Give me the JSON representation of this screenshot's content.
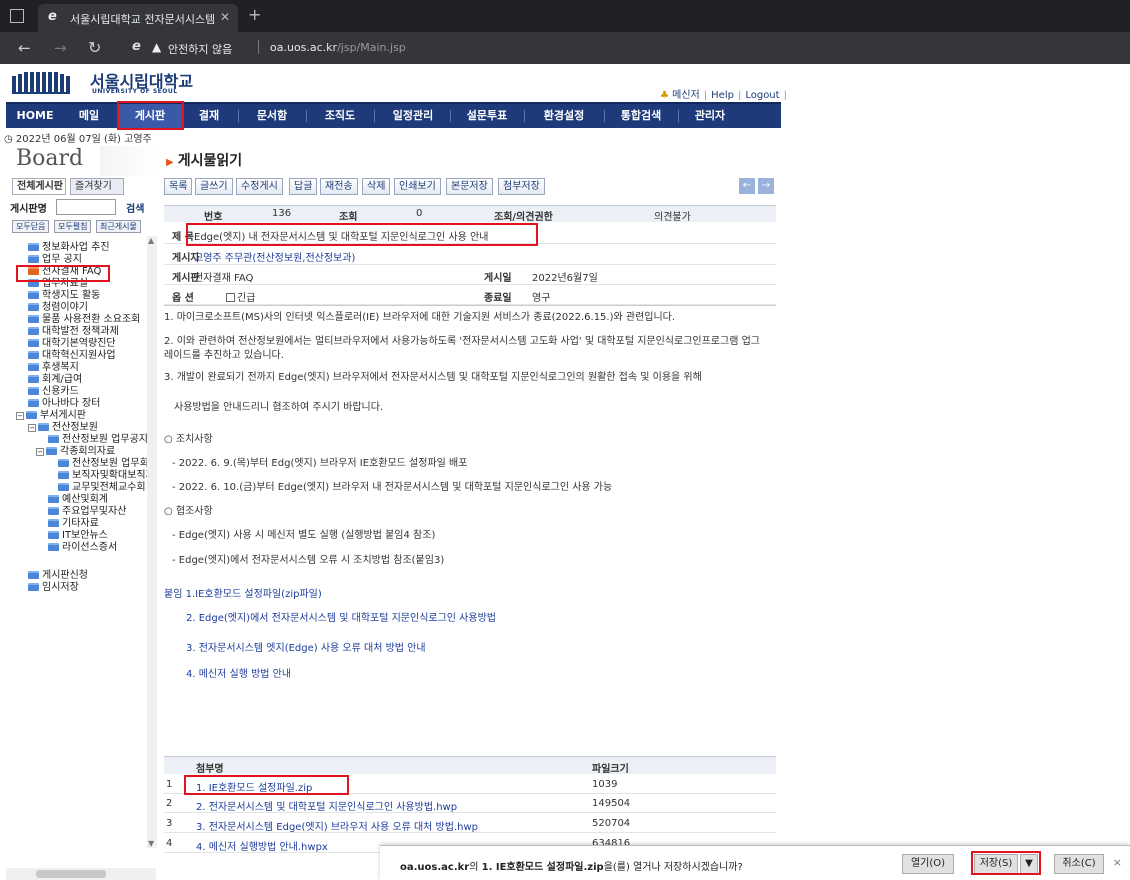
{
  "browser": {
    "tab_title": "서울시립대학교 전자문서시스템",
    "new_tab_symbol": "+",
    "security_label": "안전하지 않음",
    "url_host": "oa.uos.ac.kr",
    "url_path": "/jsp/Main.jsp"
  },
  "header": {
    "logo_name": "서울시립대학교",
    "logo_sub": "UNIVERSITY OF SEOUL",
    "links": [
      "메신저",
      "Help",
      "Logout"
    ]
  },
  "gnb": {
    "items": [
      "HOME",
      "메일",
      "게시판",
      "결재",
      "문서함",
      "조직도",
      "일정관리",
      "설문투표",
      "환경설정",
      "통합검색",
      "관리자"
    ],
    "active_index": 2
  },
  "dateline": "2022년 06월 07일 (화) 고영주",
  "sidebar": {
    "board_title": "Board",
    "tabs": [
      "전체게시판",
      "즐겨찾기"
    ],
    "search_label": "게시판명",
    "search_button": "검색",
    "mini_buttons": [
      "모두닫음",
      "모두펼침",
      "최근게시물"
    ],
    "tree": [
      "정보화사업 추진",
      "업무 공지",
      "전자결재 FAQ",
      "업무자료실",
      "학생지도 활동",
      "청렴이야기",
      "물품 사용전환 소요조회",
      "대학발전 정책과제",
      "대학기본역량진단",
      "대학혁신지원사업",
      "후생복지",
      "회계/급여",
      "신용카드",
      "아나바다 장터",
      "부서게시판",
      "전산정보원",
      "전산정보원 업무공지",
      "각종회의자료",
      "전산정보원 업무회의",
      "보직자및확대보직자",
      "교무및전체교수회",
      "예산및회계",
      "주요업무및자산",
      "기타자료",
      "IT보안뉴스",
      "라이선스증서",
      "게시판신청",
      "임시저장"
    ]
  },
  "post": {
    "page_heading": "게시물읽기",
    "toolbar": [
      "목록",
      "글쓰기",
      "수정게시",
      "답글",
      "재전송",
      "삭제",
      "인쇄보기",
      "본문저장",
      "첨부저장"
    ],
    "prev_symbol": "←",
    "next_symbol": "→",
    "meta": {
      "no_label": "번호",
      "no_value": "136",
      "views_label": "조회",
      "views_value": "0",
      "comment_label": "조회/의견권한",
      "comment_value": "의견불가"
    },
    "subject_label": "제 목",
    "subject": "Edge(엣지) 내 전자문서시스템 및 대학포털 지문인식로그인 사용 안내",
    "author_label": "게시자",
    "author": "고영주 주무관(전산정보원,전산정보과)",
    "board_label": "게시판",
    "board": "전자결재 FAQ",
    "posted_label": "게시일",
    "posted": "2022년6월7일",
    "option_label": "옵 션",
    "option": "긴급",
    "end_label": "종료일",
    "end": "영구",
    "body": [
      "1. 마이크로소프트(MS)사의 인터넷 익스플로러(IE) 브라우저에 대한 기술지원 서비스가 종료(2022.6.15.)와 관련입니다.",
      "2. 이와 관련하여 전산정보원에서는 멀티브라우저에서 사용가능하도록 '전자문서시스템 고도화 사업' 및 대학포털 지문인식로그인프로그램 업그",
      "레이드를 추진하고 있습니다.",
      "3. 개발이 완료되기 전까지 Edge(엣지) 브라우저에서 전자문서시스템 및 대학포털 지문인식로그인의 원활한 접속 및 이용을 위해",
      "사용방법을 안내드리니 협조하여 주시기 바랍니다.",
      "○ 조치사항",
      "- 2022. 6. 9.(목)부터 Edg(엣지) 브라우저 IE호환모드 설정파일 배포",
      "- 2022. 6. 10.(금)부터 Edge(엣지) 브라우저 내 전자문서시스템 및 대학포털 지문인식로그인 사용 가능",
      "○ 협조사항",
      "- Edge(엣지) 사용 시 메신저 별도 실행 (실행방법 붙임4 참조)",
      "- Edge(엣지)에서 전자문서시스템 오류 시 조치방법 참조(붙임3)",
      "붙임 1.IE호환모드 설정파일(zip파일)",
      "2. Edge(엣지)에서 전자문서시스템 및 대학포털 지문인식로그인 사용방법",
      "3. 전자문서시스템 엣지(Edge) 사용 오류 대처 방법 안내",
      "4. 메신저 실행 방법 안내"
    ],
    "attach_header_name": "첨부명",
    "attach_header_size": "파일크기",
    "attachments": [
      {
        "num": "1",
        "name": "1. IE호환모드 설정파일.zip",
        "size": "1039"
      },
      {
        "num": "2",
        "name": "2. 전자문서시스템 및 대학포털 지문인식로그인 사용방법.hwp",
        "size": "149504"
      },
      {
        "num": "3",
        "name": "3. 전자문서시스템 Edge(엣지) 브라우저 사용 오류 대처 방법.hwp",
        "size": "520704"
      },
      {
        "num": "4",
        "name": "4. 메신저 실행방법 안내.hwpx",
        "size": "634816"
      }
    ]
  },
  "download_bar": {
    "host": "oa.uos.ac.kr",
    "middle": "의 ",
    "file": "1. IE호환모드 설정파일.zip",
    "suffix": "을(를) 열거나 저장하시겠습니까?",
    "open": "열기(O)",
    "save": "저장(S)",
    "dropdown": "▼",
    "cancel": "취소(C)",
    "close": "×"
  },
  "colors": {
    "nav_bg": "#1e3a7a",
    "nav_active": "#3a5aa8",
    "highlight": "#e0141e",
    "link": "#1c3c9a"
  }
}
